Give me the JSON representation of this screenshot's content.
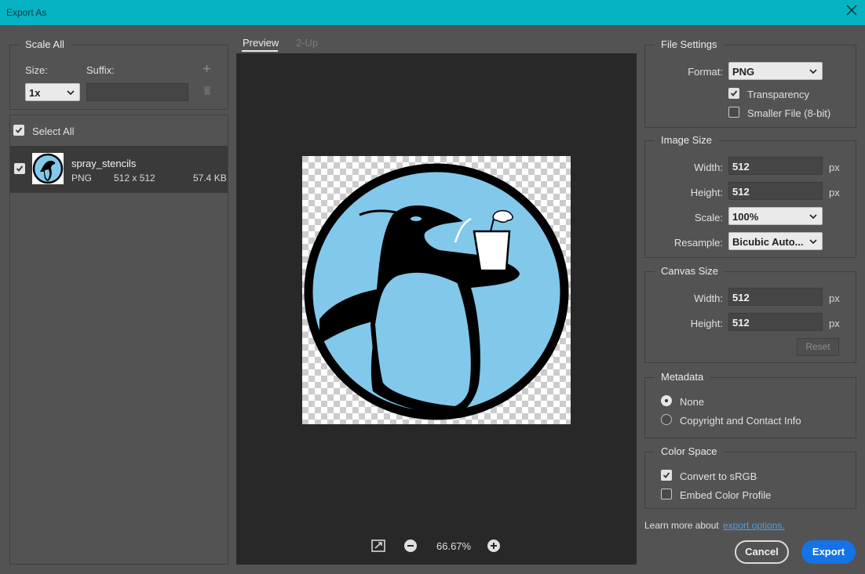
{
  "window": {
    "title": "Export As"
  },
  "scale_all": {
    "legend": "Scale All",
    "size_label": "Size:",
    "suffix_label": "Suffix:",
    "size_value": "1x",
    "suffix_value": ""
  },
  "select_all": {
    "label": "Select All",
    "checked": true
  },
  "file_item": {
    "name": "spray_stencils",
    "format": "PNG",
    "dimensions": "512 x 512",
    "size": "57.4 KB",
    "checked": true
  },
  "preview": {
    "tabs": [
      {
        "label": "Preview",
        "active": true
      },
      {
        "label": "2-Up",
        "active": false
      }
    ],
    "zoom": "66.67%"
  },
  "file_settings": {
    "legend": "File Settings",
    "format_label": "Format:",
    "format_value": "PNG",
    "transparency_label": "Transparency",
    "transparency_checked": true,
    "smaller_file_label": "Smaller File (8-bit)",
    "smaller_file_checked": false
  },
  "image_size": {
    "legend": "Image Size",
    "width_label": "Width:",
    "width_value": "512",
    "height_label": "Height:",
    "height_value": "512",
    "scale_label": "Scale:",
    "scale_value": "100%",
    "resample_label": "Resample:",
    "resample_value": "Bicubic Auto...",
    "unit": "px"
  },
  "canvas_size": {
    "legend": "Canvas Size",
    "width_label": "Width:",
    "width_value": "512",
    "height_label": "Height:",
    "height_value": "512",
    "unit": "px",
    "reset_label": "Reset"
  },
  "metadata": {
    "legend": "Metadata",
    "options": [
      {
        "label": "None",
        "selected": true
      },
      {
        "label": "Copyright and Contact Info",
        "selected": false
      }
    ]
  },
  "color_space": {
    "legend": "Color Space",
    "srgb_label": "Convert to sRGB",
    "srgb_checked": true,
    "embed_label": "Embed Color Profile",
    "embed_checked": false
  },
  "footer": {
    "learn_more": "Learn more about",
    "link_text": "export options.",
    "cancel_label": "Cancel",
    "export_label": "Export"
  },
  "colors": {
    "title_bar": "#05b3c2",
    "accent_button": "#1473e6",
    "link": "#4f9fe8",
    "penguin_background": "#82c8ea"
  }
}
